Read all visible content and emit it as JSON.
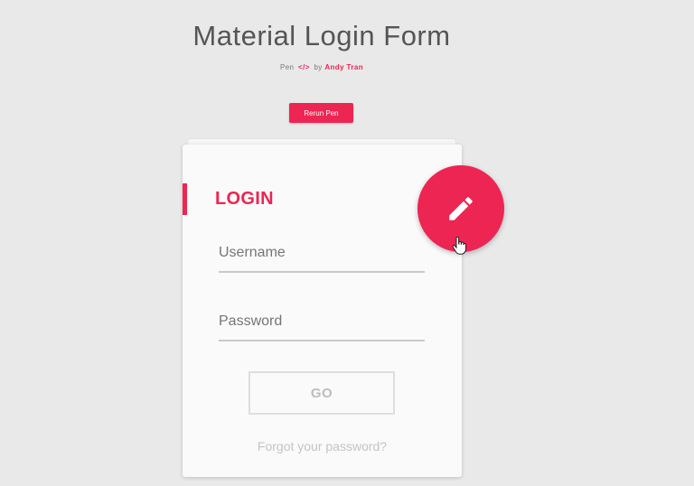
{
  "header": {
    "title": "Material Login Form",
    "byline_prefix": "Pen",
    "byline_code_icon": "</>",
    "byline_by": "by",
    "author": "Andy Tran"
  },
  "toolbar": {
    "rerun_label": "Rerun Pen"
  },
  "login_card": {
    "heading": "LOGIN",
    "username": {
      "placeholder": "Username",
      "value": ""
    },
    "password": {
      "placeholder": "Password",
      "value": ""
    },
    "submit_label": "GO",
    "forgot_label": "Forgot your password?"
  },
  "fab": {
    "icon": "pencil-icon"
  },
  "colors": {
    "accent": "#ed2553",
    "background": "#e9e9e9",
    "card": "#fafafa"
  }
}
